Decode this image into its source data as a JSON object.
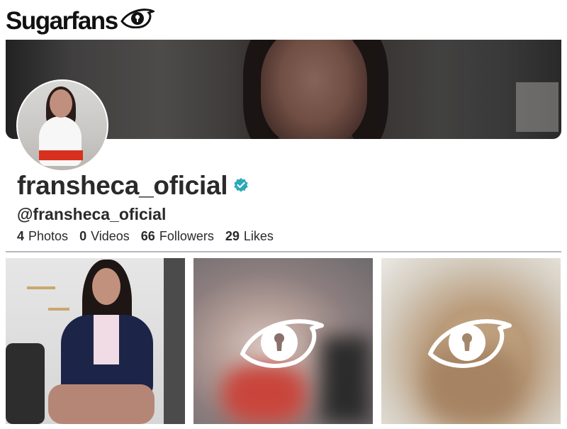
{
  "brand": {
    "name": "Sugarfans",
    "icon": "eye-logo-icon"
  },
  "profile": {
    "display_name": "fransheca_oficial",
    "verified_icon": "verified-badge-icon",
    "handle": "@fransheca_oficial",
    "stats": [
      {
        "value": "4",
        "label": "Photos"
      },
      {
        "value": "0",
        "label": "Videos"
      },
      {
        "value": "66",
        "label": "Followers"
      },
      {
        "value": "29",
        "label": "Likes"
      }
    ]
  },
  "colors": {
    "verified": "#2aa9b8",
    "divider": "#b9b7bf",
    "text": "#2a2a2a"
  },
  "media": [
    {
      "type": "photo",
      "locked": false
    },
    {
      "type": "photo",
      "locked": true,
      "icon": "locked-eye-icon"
    },
    {
      "type": "photo",
      "locked": true,
      "icon": "locked-eye-icon"
    }
  ]
}
